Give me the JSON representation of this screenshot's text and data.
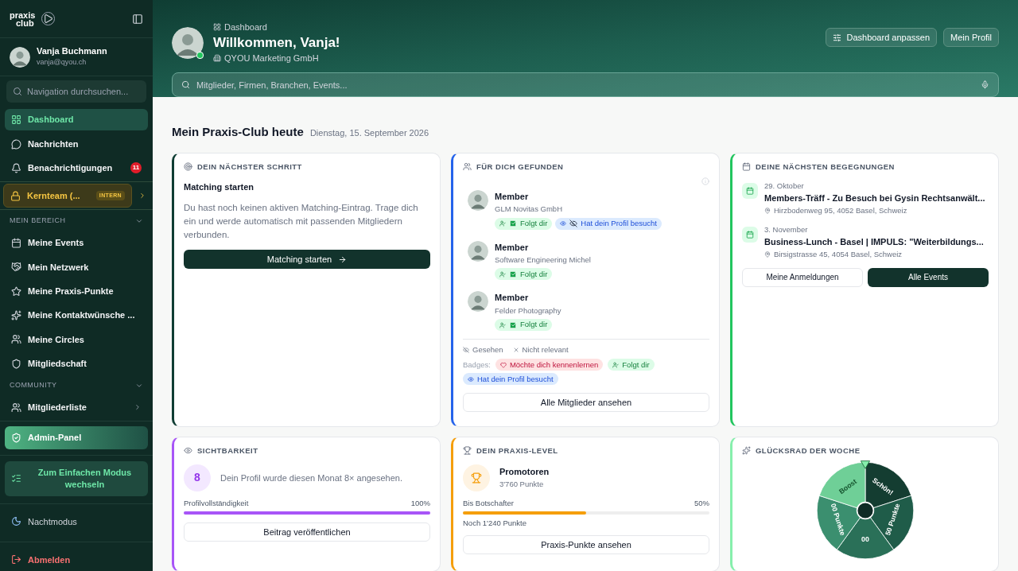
{
  "sidebar": {
    "logo": {
      "line1": "praxis",
      "line2": "club"
    },
    "user": {
      "name": "Vanja Buchmann",
      "email": "vanja@qyou.ch"
    },
    "search": {
      "placeholder": "Navigation durchsuchen..."
    },
    "items": [
      {
        "kind": "item",
        "label": "Dashboard",
        "selected": true
      },
      {
        "kind": "item",
        "label": "Nachrichten",
        "selected": false
      },
      {
        "kind": "item",
        "label": "Benachrichtigungen",
        "selected": false,
        "badge": "11"
      },
      {
        "kind": "team",
        "label": "Kernteam (...",
        "tag": "INTERN",
        "selected": false
      },
      {
        "kind": "section",
        "label": "MEIN BEREICH",
        "expanded": true
      },
      {
        "kind": "item",
        "label": "Meine Events",
        "selected": false
      },
      {
        "kind": "item",
        "label": "Mein Netzwerk",
        "selected": false
      },
      {
        "kind": "item",
        "label": "Meine Praxis-Punkte",
        "selected": false
      },
      {
        "kind": "item",
        "label": "Meine Kontaktwünsche ...",
        "selected": false
      },
      {
        "kind": "item",
        "label": "Meine Circles",
        "selected": false
      },
      {
        "kind": "item",
        "label": "Mitgliedschaft",
        "selected": false
      },
      {
        "kind": "section",
        "label": "COMMUNITY",
        "expanded": true
      },
      {
        "kind": "submenu",
        "label": "Mitgliederliste",
        "selected": false
      },
      {
        "kind": "admin",
        "label": "Admin-Panel",
        "selected": false
      },
      {
        "kind": "mode",
        "label": "Zum Einfachen Modus wechseln"
      },
      {
        "kind": "theme",
        "label": "Nachtmodus"
      },
      {
        "kind": "logout",
        "label": "Abmelden"
      }
    ]
  },
  "header": {
    "breadcrumb": "Dashboard",
    "title": "Willkommen, Vanja!",
    "company": "QYOU Marketing GmbH",
    "online": true,
    "buttons": [
      "Dashboard anpassen",
      "Mein Profil"
    ],
    "search": {
      "placeholder": "Mitglieder, Firmen, Branchen, Events..."
    }
  },
  "main": {
    "heading": "Mein Praxis-Club heute",
    "date": "Dienstag, 15. September 2026",
    "next_step": {
      "title": "DEIN NÄCHSTER SCHRITT",
      "subtitle": "Matching starten",
      "text": "Du hast noch keinen aktiven Matching-Eintrag. Trage dich ein und werde automatisch mit passenden Mitgliedern verbunden.",
      "button": "Matching starten"
    },
    "found": {
      "title": "FÜR DICH GEFUNDEN",
      "members": [
        {
          "name": "Member",
          "company": "GLM Novitas GmbH",
          "badges": [
            {
              "kind": "follow",
              "label": "Folgt dir"
            },
            {
              "kind": "visit",
              "label": "Hat dein Profil besucht"
            }
          ]
        },
        {
          "name": "Member",
          "company": "Software Engineering Michel",
          "badges": [
            {
              "kind": "follow",
              "label": "Folgt dir"
            }
          ]
        },
        {
          "name": "Member",
          "company": "Felder Photography",
          "badges": [
            {
              "kind": "follow",
              "label": "Folgt dir"
            }
          ]
        }
      ],
      "actions": [
        "Gesehen",
        "Nicht relevant"
      ],
      "legend_label": "Badges:",
      "legend": [
        {
          "kind": "meet",
          "label": "Möchte dich kennenlernen"
        },
        {
          "kind": "follow",
          "label": "Folgt dir"
        },
        {
          "kind": "visit",
          "label": "Hat dein Profil besucht"
        }
      ],
      "button": "Alle Mitglieder ansehen"
    },
    "events": {
      "title": "DEINE NÄCHSTEN BEGEGNUNGEN",
      "items": [
        {
          "date": "29. Oktober",
          "name": "Members-Träff - Zu Besuch bei Gysin Rechtsanwält...",
          "place": "Hirzbodenweg 95, 4052 Basel, Schweiz"
        },
        {
          "date": "3. November",
          "name": "Business-Lunch - Basel | IMPULS: \"Weiterbildungs...",
          "place": "Birsigstrasse 45, 4054 Basel, Schweiz"
        }
      ],
      "buttons": [
        "Meine Anmeldungen",
        "Alle Events"
      ]
    },
    "visibility": {
      "title": "SICHTBARKEIT",
      "count": "8",
      "text": "Dein Profil wurde diesen Monat 8× angesehen.",
      "progress_label": "Profilvollständigkeit",
      "progress_value": "100%",
      "level": 1,
      "button": "Beitrag veröffentlichen"
    },
    "praxis_level": {
      "title": "DEIN PRAXIS-LEVEL",
      "rank": "Promotoren",
      "points": "3'760 Punkte",
      "progress_label": "Bis Botschafter",
      "progress_value": "50%",
      "level": 0.5,
      "remaining": "Noch 1'240 Punkte",
      "button": "Praxis-Punkte ansehen"
    },
    "wheel": {
      "title": "GLÜCKSRAD DER WOCHE",
      "segments": [
        {
          "label": "Schön!",
          "color": "#143d31"
        },
        {
          "label": "50 Punkte",
          "color": "#1f5c49"
        },
        {
          "label": "00",
          "color": "#2a7058"
        },
        {
          "label": "00 Punkte",
          "color": "#3b8f6f"
        },
        {
          "label": "Boost",
          "color": "#6fcf97"
        }
      ]
    }
  }
}
